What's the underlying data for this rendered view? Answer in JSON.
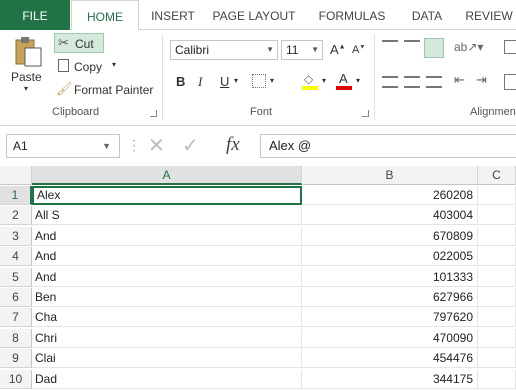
{
  "tabs": [
    "FILE",
    "HOME",
    "INSERT",
    "PAGE LAYOUT",
    "FORMULAS",
    "DATA",
    "REVIEW"
  ],
  "clipboard": {
    "paste": "Paste",
    "cut": "Cut",
    "copy": "Copy",
    "format_painter": "Format Painter",
    "group_label": "Clipboard"
  },
  "font": {
    "name": "Calibri",
    "size": "11",
    "bold": "B",
    "italic": "I",
    "underline": "U",
    "font_color_glyph": "A",
    "grow_glyph": "A",
    "shrink_glyph": "A",
    "group_label": "Font"
  },
  "alignment": {
    "group_label": "Alignmen"
  },
  "formula_bar": {
    "name_box": "A1",
    "fx": "fx",
    "formula": "Alex @"
  },
  "sheet": {
    "columns": [
      "A",
      "B",
      "C"
    ],
    "rows": [
      {
        "n": "1",
        "a": "Alex",
        "b": "260208"
      },
      {
        "n": "2",
        "a": "All S",
        "b": "403004"
      },
      {
        "n": "3",
        "a": "And",
        "b": "670809"
      },
      {
        "n": "4",
        "a": "And",
        "b": "022005"
      },
      {
        "n": "5",
        "a": "And",
        "b": "101333"
      },
      {
        "n": "6",
        "a": "Ben",
        "b": "627966"
      },
      {
        "n": "7",
        "a": "Cha",
        "b": "797620"
      },
      {
        "n": "8",
        "a": "Chri",
        "b": "470090"
      },
      {
        "n": "9",
        "a": "Clai",
        "b": "454476"
      },
      {
        "n": "10",
        "a": "Dad",
        "b": "344175"
      }
    ]
  },
  "colors": {
    "accent": "#217346"
  }
}
